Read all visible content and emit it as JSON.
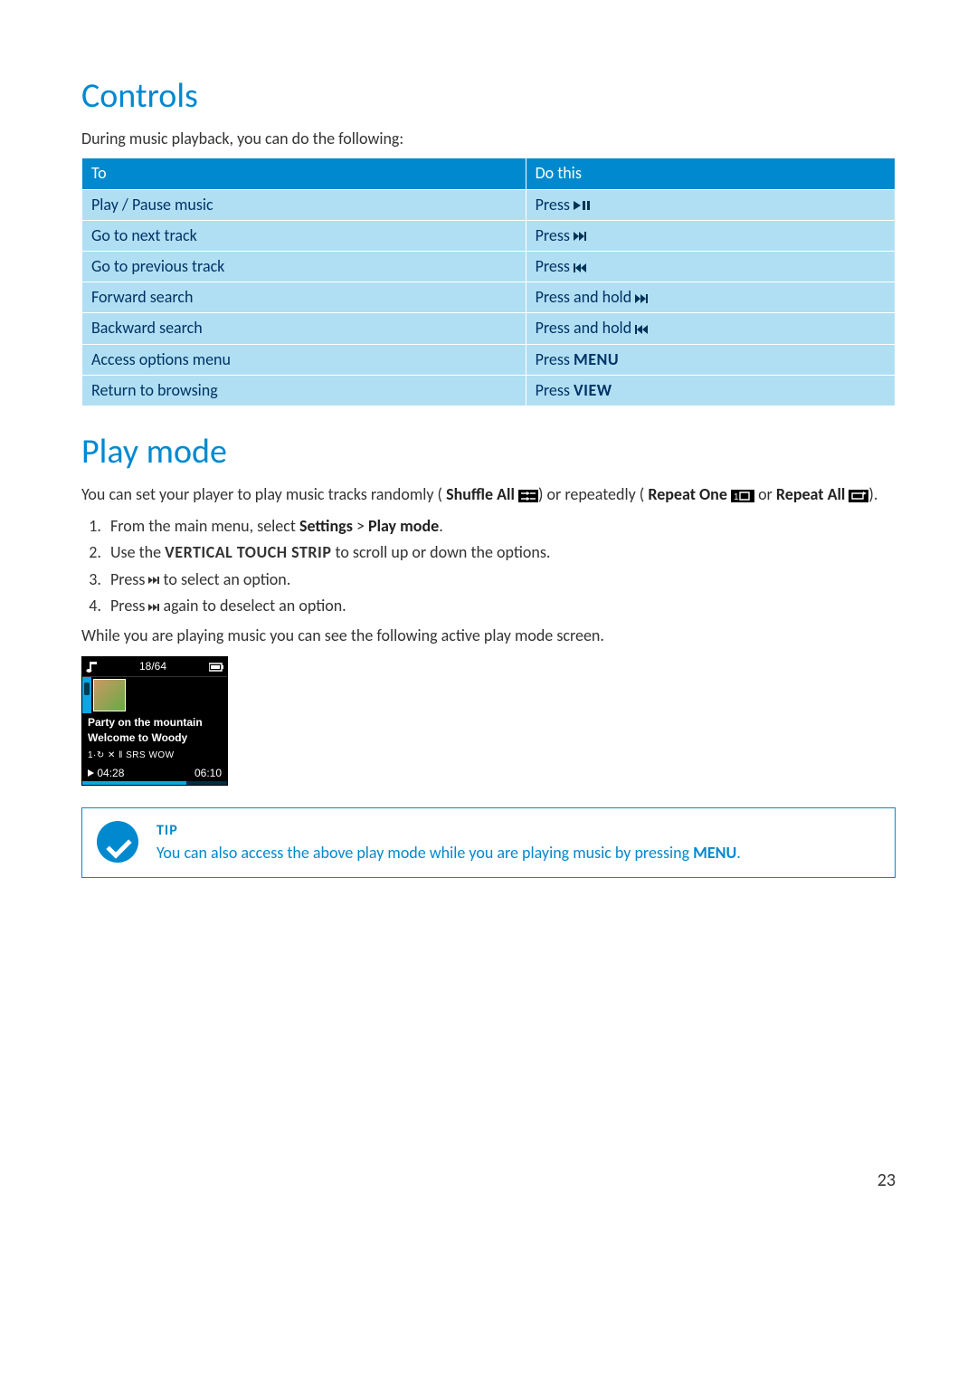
{
  "page_number": "23",
  "section_controls": {
    "heading": "Controls",
    "intro": "During music playback, you can do the following:",
    "table": {
      "headers": {
        "col1": "To",
        "col2": "Do this"
      },
      "rows": [
        {
          "to": "Play / Pause music",
          "action_prefix": "Press ",
          "icon": "play-pause"
        },
        {
          "to": "Go to next track",
          "action_prefix": "Press ",
          "icon": "next"
        },
        {
          "to": "Go to previous track",
          "action_prefix": "Press ",
          "icon": "prev"
        },
        {
          "to": "Forward search",
          "action_prefix": "Press and hold ",
          "icon": "next"
        },
        {
          "to": "Backward search",
          "action_prefix": "Press and hold ",
          "icon": "prev"
        },
        {
          "to": "Access options menu",
          "action_prefix": "Press ",
          "keyword": "MENU"
        },
        {
          "to": "Return to browsing",
          "action_prefix": "Press ",
          "keyword": "VIEW"
        }
      ]
    }
  },
  "section_playmode": {
    "heading": "Play mode",
    "para1": {
      "t1": "You can set your player to play music tracks randomly (",
      "b1": "Shuffle All",
      "t2": ") or repeatedly (",
      "b2": "Repeat One",
      "t3": " or ",
      "b3": "Repeat All",
      "t4": ")."
    },
    "steps": {
      "s1_a": "From the main menu, select ",
      "s1_b": "Settings",
      "s1_c": " > ",
      "s1_d": "Play mode",
      "s1_e": ".",
      "s2_a": "Use the ",
      "s2_b": "VERTICAL TOUCH STRIP",
      "s2_c": " to scroll up or down the options.",
      "s3_a": "Press ",
      "s3_b": " to select an option.",
      "s4_a": "Press ",
      "s4_b": " again to deselect an option."
    },
    "para2": "While you are playing music you can see the following active play mode screen."
  },
  "player_mock": {
    "count": "18/64",
    "line1": "Party on the mountain",
    "line2": "Welcome to Woody",
    "modes": "1·↻ ✕ ‖ SRS WOW",
    "time_elapsed": "04:28",
    "time_total": "06:10"
  },
  "tip": {
    "head": "TIP",
    "body_a": "You can also access the above play mode while you are playing music by pressing ",
    "body_b": "MENU",
    "body_c": "."
  }
}
